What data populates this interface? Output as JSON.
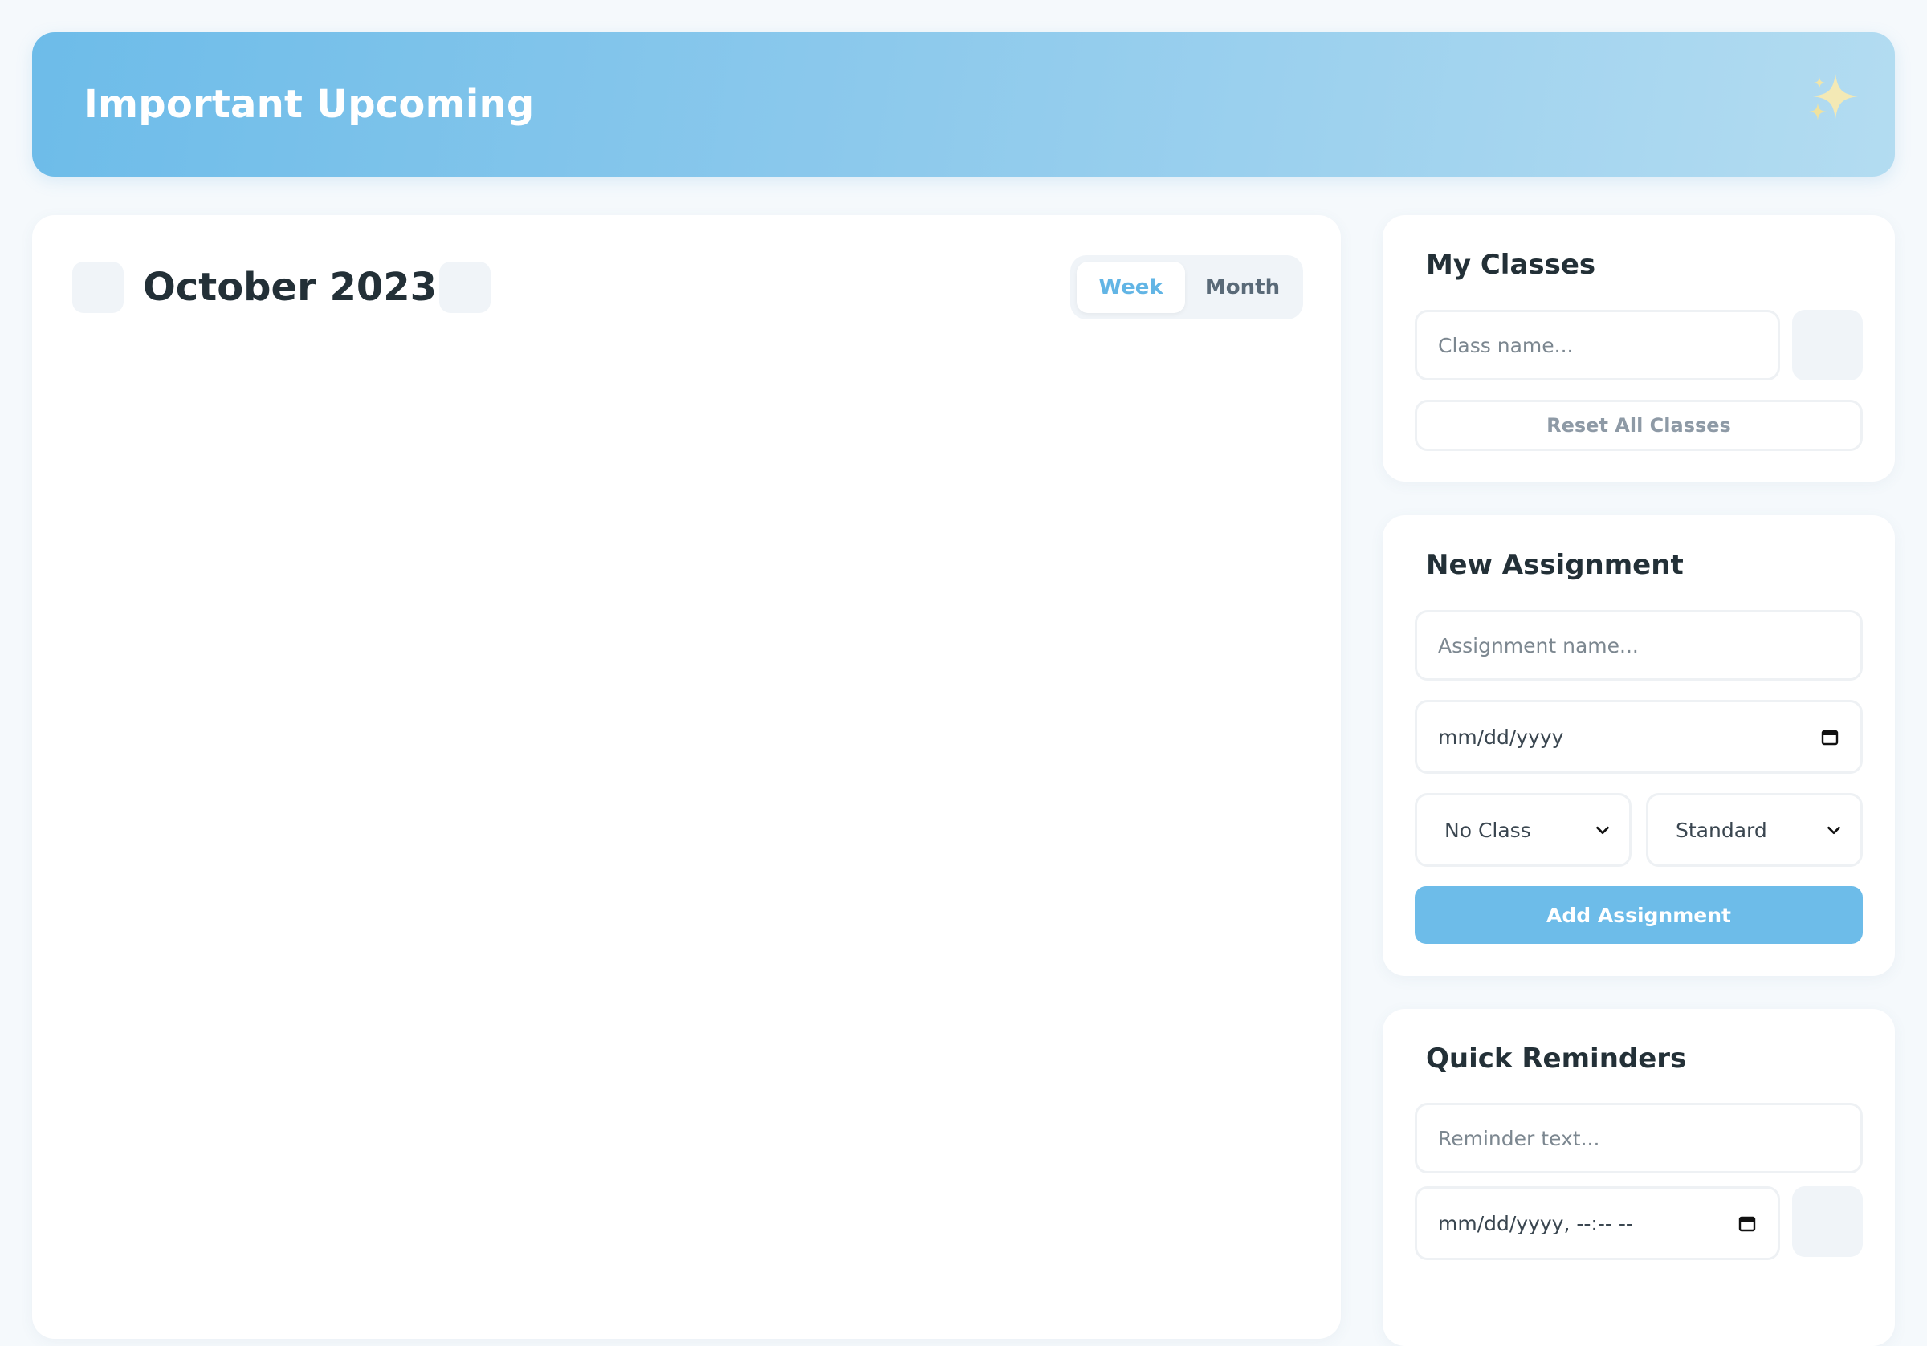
{
  "header": {
    "title": "Important Upcoming",
    "icon": "sparkles-icon"
  },
  "calendar": {
    "title": "October 2023",
    "prev_icon": "chevron-left-icon",
    "next_icon": "chevron-right-icon",
    "views": {
      "week": "Week",
      "month": "Month",
      "active": "week"
    }
  },
  "classes": {
    "title": "My Classes",
    "input_placeholder": "Class name...",
    "reset_label": "Reset All Classes"
  },
  "assignment": {
    "title": "New Assignment",
    "name_placeholder": "Assignment name...",
    "date_placeholder": "mm/dd/yyyy",
    "class_select": "No Class",
    "type_select": "Standard",
    "submit_label": "Add Assignment"
  },
  "reminders": {
    "title": "Quick Reminders",
    "text_placeholder": "Reminder text...",
    "datetime_placeholder": "mm/dd/yyyy, --:-- --"
  },
  "colors": {
    "accent": "#6dbce9",
    "accent_text": "#62b5e5",
    "text": "#233037",
    "muted": "#f0f4f8"
  }
}
